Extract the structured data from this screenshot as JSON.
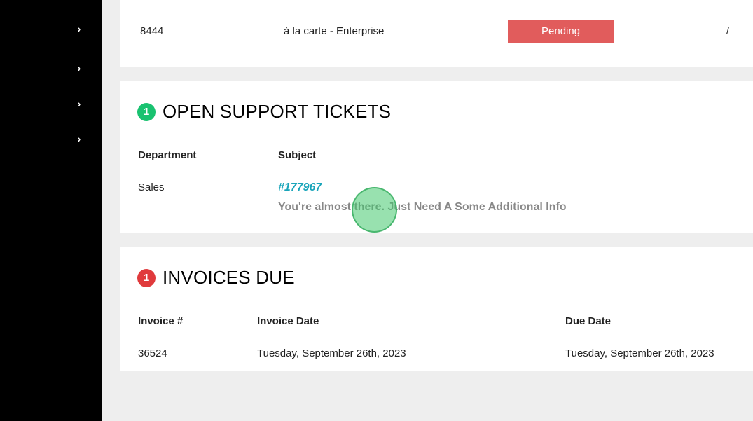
{
  "sidebar": {
    "items": [
      {
        "icon": "chevron-right"
      },
      {
        "icon": "chevron-right"
      },
      {
        "icon": "chevron-right"
      },
      {
        "icon": "chevron-right"
      }
    ]
  },
  "order": {
    "id": "8444",
    "name": "à la carte - Enterprise",
    "status": "Pending",
    "action": "/"
  },
  "tickets": {
    "count": "1",
    "title": "OPEN SUPPORT TICKETS",
    "headers": {
      "department": "Department",
      "subject": "Subject"
    },
    "rows": [
      {
        "department": "Sales",
        "ticket_number": "#177967",
        "description": "You're almost there. Just Need A Some Additional Info"
      }
    ]
  },
  "invoices": {
    "count": "1",
    "title": "INVOICES DUE",
    "headers": {
      "invoice_num": "Invoice #",
      "invoice_date": "Invoice Date",
      "due_date": "Due Date"
    },
    "rows": [
      {
        "number": "36524",
        "date": "Tuesday, September 26th, 2023",
        "due": "Tuesday, September 26th, 2023"
      }
    ]
  }
}
